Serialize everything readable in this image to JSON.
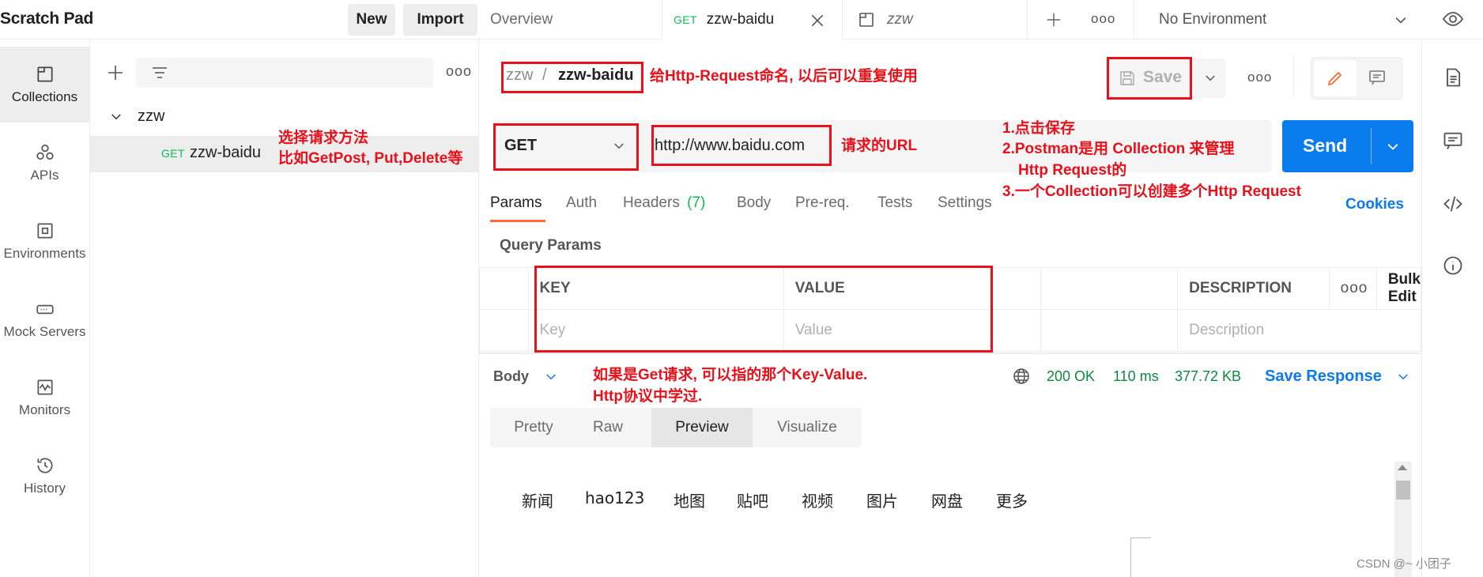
{
  "sidebar": {
    "title": "Scratch Pad",
    "new_label": "New",
    "import_label": "Import",
    "items": [
      {
        "label": "Collections",
        "icon": "collections-icon"
      },
      {
        "label": "APIs",
        "icon": "apis-icon"
      },
      {
        "label": "Environments",
        "icon": "environments-icon"
      },
      {
        "label": "Mock Servers",
        "icon": "mock-servers-icon"
      },
      {
        "label": "Monitors",
        "icon": "monitors-icon"
      },
      {
        "label": "History",
        "icon": "history-icon"
      }
    ]
  },
  "tree": {
    "collection_name": "zzw",
    "request_method": "GET",
    "request_name": "zzw-baidu"
  },
  "tabs": {
    "overview": "Overview",
    "active_method": "GET",
    "active_name": "zzw-baidu",
    "second_name": "zzw",
    "environment": "No Environment"
  },
  "request": {
    "breadcrumb_collection": "zzw",
    "breadcrumb_separator": "/",
    "breadcrumb_request": "zzw-baidu",
    "save_label": "Save",
    "method": "GET",
    "url": "http://www.baidu.com",
    "send_label": "Send",
    "subtabs": {
      "params": "Params",
      "auth": "Auth",
      "headers": "Headers",
      "headers_count": "(7)",
      "body": "Body",
      "prereq": "Pre-req.",
      "tests": "Tests",
      "settings": "Settings",
      "cookies": "Cookies"
    },
    "query_params_title": "Query Params",
    "columns": {
      "key": "KEY",
      "value": "VALUE",
      "description": "DESCRIPTION",
      "bulk_edit": "Bulk Edit"
    },
    "placeholders": {
      "key": "Key",
      "value": "Value",
      "description": "Description"
    }
  },
  "response": {
    "body_label": "Body",
    "status": "200 OK",
    "time": "110 ms",
    "size": "377.72 KB",
    "save_response": "Save Response",
    "view_tabs": [
      "Pretty",
      "Raw",
      "Preview",
      "Visualize"
    ],
    "active_view": "Preview",
    "preview_links": [
      "新闻",
      "hao123",
      "地图",
      "贴吧",
      "视频",
      "图片",
      "网盘",
      "更多"
    ]
  },
  "annotations": {
    "name_note": "给Http-Request命名, 以后可以重复使用",
    "method_note_1": "选择请求方法",
    "method_note_2": "比如GetPost, Put,Delete等",
    "url_note": "请求的URL",
    "save_note_1": "1.点击保存",
    "save_note_2": "2.Postman是用 Collection 来管理",
    "save_note_3": "Http Request的",
    "save_note_4": "3.一个Collection可以创建多个Http Request",
    "params_note_1": "如果是Get请求, 可以指的那个Key-Value.",
    "params_note_2": "Http协议中学过."
  },
  "watermark": "CSDN @~ 小团子",
  "colors": {
    "accent": "#ff6c37",
    "send": "#097bed",
    "get": "#0cbb52",
    "annotation": "#e8101a",
    "link": "#097bed"
  }
}
